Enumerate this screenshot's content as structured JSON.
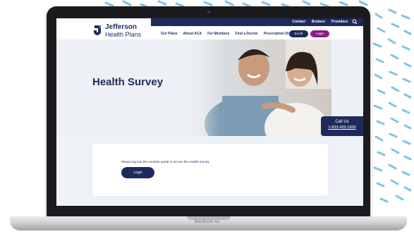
{
  "header": {
    "top_links": [
      "Contact",
      "Brokers",
      "Providers"
    ],
    "logo_line1": "Jefferson",
    "logo_line2": "Health Plans",
    "nav_items": [
      "Our Plans",
      "About ACA",
      "For Members",
      "Find a Doctor",
      "Prescription Drugs"
    ],
    "enroll_label": "Enroll",
    "login_label": "Login"
  },
  "hero": {
    "title": "Health Survey"
  },
  "call_box": {
    "title": "Call Us",
    "phone": "1-833-435-1900"
  },
  "survey_card": {
    "message": "Please log into the member portal to access the Health Survey.",
    "login_label": "Login"
  },
  "device": {
    "model_label": "MacBook Air"
  },
  "colors": {
    "navy": "#1f2a5c",
    "magenta": "#8a1e86",
    "dash_blue": "#7fc3ea"
  }
}
